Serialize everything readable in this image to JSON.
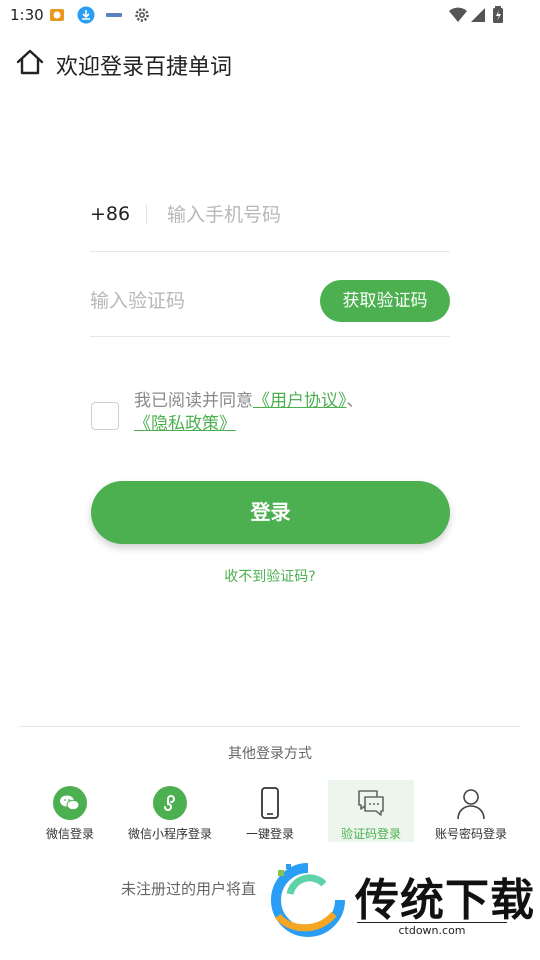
{
  "status_bar": {
    "time": "1:30"
  },
  "header": {
    "title": "欢迎登录百捷单词",
    "home_icon": "home-icon"
  },
  "form": {
    "country_code": "+86",
    "phone_placeholder": "输入手机号码",
    "code_placeholder": "输入验证码",
    "get_code_label": "获取验证码"
  },
  "agreement": {
    "prefix": "我已阅读并同意",
    "user_agreement": "《用户协议》",
    "separator": "、",
    "privacy_policy": "《隐私政策》"
  },
  "login_label": "登录",
  "no_code_link": "收不到验证码?",
  "other_login": {
    "title": "其他登录方式",
    "options": [
      {
        "label": "微信登录",
        "icon": "wechat-icon"
      },
      {
        "label": "微信小程序登录",
        "icon": "mini-program-icon"
      },
      {
        "label": "一键登录",
        "icon": "phone-icon"
      },
      {
        "label": "验证码登录",
        "icon": "chat-icon",
        "active": true
      },
      {
        "label": "账号密码登录",
        "icon": "person-icon"
      }
    ]
  },
  "footer_text": "未注册过的用户将直",
  "watermark": {
    "name": "传统下载",
    "url": "ctdown.com"
  },
  "colors": {
    "accent": "#4caf50",
    "placeholder": "#b8b8b8"
  }
}
